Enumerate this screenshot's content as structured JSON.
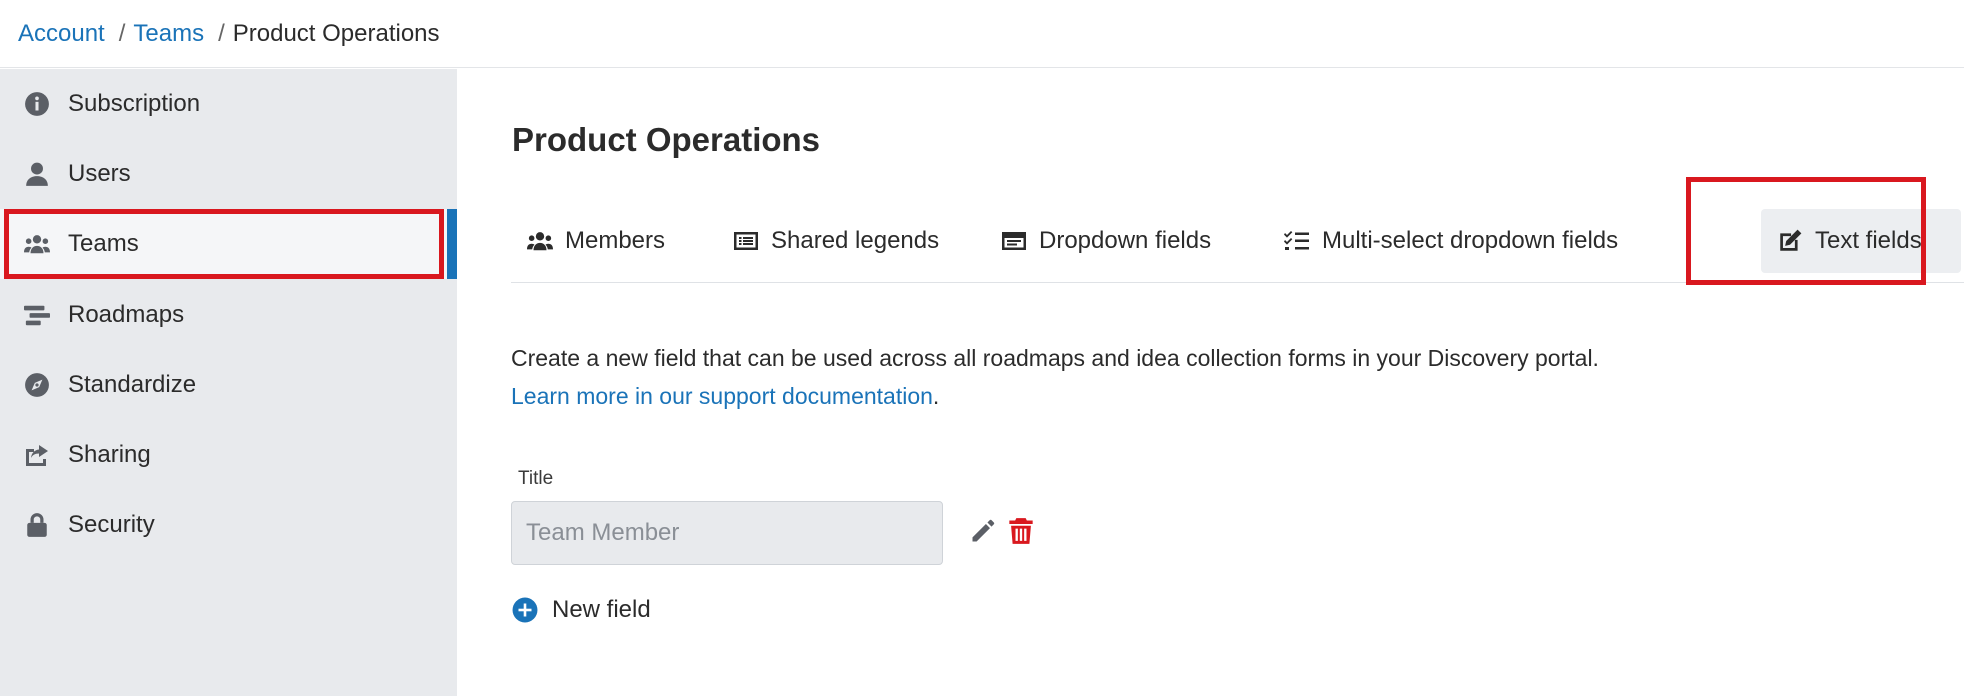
{
  "breadcrumb": {
    "items": [
      {
        "label": "Account",
        "link": true
      },
      {
        "label": "Teams",
        "link": true
      },
      {
        "label": "Product Operations",
        "link": false
      }
    ],
    "separator": "/"
  },
  "sidebar": {
    "items": [
      {
        "label": "Subscription",
        "icon": "info-icon"
      },
      {
        "label": "Users",
        "icon": "user-icon"
      },
      {
        "label": "Teams",
        "icon": "users-group-icon",
        "active": true
      },
      {
        "label": "Roadmaps",
        "icon": "roadmap-icon"
      },
      {
        "label": "Standardize",
        "icon": "compass-icon"
      },
      {
        "label": "Sharing",
        "icon": "share-icon"
      },
      {
        "label": "Security",
        "icon": "lock-icon"
      }
    ]
  },
  "main": {
    "title": "Product Operations",
    "tabs": [
      {
        "label": "Members",
        "icon": "users-icon"
      },
      {
        "label": "Shared legends",
        "icon": "legend-list-icon"
      },
      {
        "label": "Dropdown fields",
        "icon": "dropdown-icon"
      },
      {
        "label": "Multi-select dropdown fields",
        "icon": "checklist-icon"
      },
      {
        "label": "Text fields",
        "icon": "edit-square-icon",
        "active": true
      }
    ],
    "description": "Create a new field that can be used across all roadmaps and idea collection forms in your Discovery portal.",
    "support_link": "Learn more in our support documentation",
    "support_link_suffix": ".",
    "field": {
      "label": "Title",
      "value": "Team Member"
    },
    "new_field_label": "New field"
  },
  "colors": {
    "accent": "#1a73b8",
    "highlight": "#d9181f",
    "sidebar_bg": "#e8eaed"
  }
}
